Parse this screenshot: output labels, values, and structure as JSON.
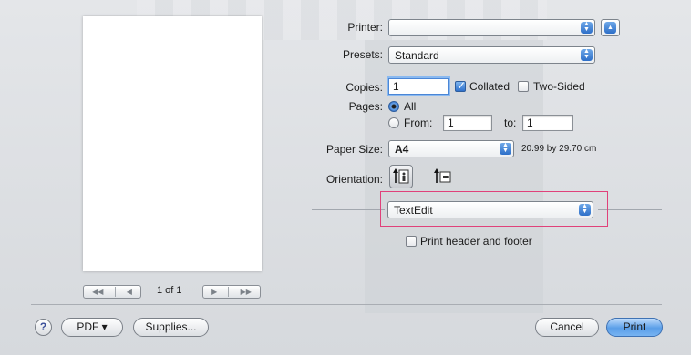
{
  "form": {
    "printer_label": "Printer:",
    "printer_value": "",
    "presets_label": "Presets:",
    "presets_value": "Standard",
    "copies_label": "Copies:",
    "copies_value": "1",
    "collated_label": "Collated",
    "collated_checked": true,
    "two_sided_label": "Two-Sided",
    "two_sided_checked": false,
    "pages_label": "Pages:",
    "pages_all_label": "All",
    "pages_from_label": "From:",
    "pages_from_value": "1",
    "pages_to_label": "to:",
    "pages_to_value": "1",
    "paper_size_label": "Paper Size:",
    "paper_size_value": "A4",
    "paper_dimensions": "20.99 by 29.70 cm",
    "orientation_label": "Orientation:",
    "section_value": "TextEdit",
    "print_header_footer_label": "Print header and footer",
    "print_header_footer_checked": false
  },
  "preview": {
    "page_count": "1 of 1"
  },
  "footer": {
    "help_label": "?",
    "pdf_label": "PDF ▾",
    "supplies_label": "Supplies...",
    "cancel_label": "Cancel",
    "print_label": "Print"
  },
  "colors": {
    "highlight": "#e0417a",
    "accent": "#2f71cc"
  }
}
